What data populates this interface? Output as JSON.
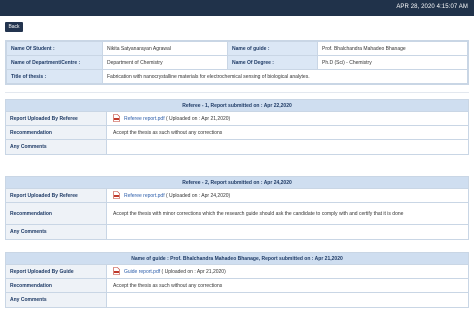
{
  "header": {
    "datetime": "APR 28, 2020   4:15:07 AM"
  },
  "back_label": "Back",
  "student": {
    "name_label": "Name Of Student :",
    "name_value": "Nikita Satyanarayan Agrawal",
    "guide_label": "Name of guide :",
    "guide_value": "Prof. Bhalchandra Mahadeo Bhanage",
    "dept_label": "Name of Department/Centre :",
    "dept_value": "Department of Chemistry",
    "degree_label": "Name Of Degree :",
    "degree_value": "Ph.D (Sci) - Chemistry",
    "thesis_label": "Title of thesis :",
    "thesis_value": "Fabrication with nanocrystalline materials for electrochemical sensing of biological analytes."
  },
  "sections": [
    {
      "title": "Referee - 1, Report submitted on : Apr 22,2020",
      "report_label": "Report Uploaded By Referee",
      "file_link": "Referee report.pdf",
      "file_date": "( Uploaded on : Apr 21,2020)",
      "recommendation_label": "Recommendation",
      "recommendation_value": "Accept the thesis as such without any corrections",
      "comments_label": "Any Comments",
      "comments_value": ""
    },
    {
      "title": "Referee - 2, Report submitted on : Apr 24,2020",
      "report_label": "Report Uploaded By Referee",
      "file_link": "Referee report.pdf",
      "file_date": "( Uploaded on : Apr 24,2020)",
      "recommendation_label": "Recommendation",
      "recommendation_value": "Accept the thesis with minor corrections which the research guide should ask the candidate to comply with and certify that it is done",
      "comments_label": "Any Comments",
      "comments_value": ""
    },
    {
      "title": "Name of guide : Prof. Bhalchandra Mahadeo Bhanage, Report submitted on : Apr 21,2020",
      "report_label": "Report Uploaded By Guide",
      "file_link": "Guide report.pdf",
      "file_date": "( Uploaded on : Apr 21,2020)",
      "recommendation_label": "Recommendation",
      "recommendation_value": "Accept the thesis as such without any corrections",
      "comments_label": "Any Comments",
      "comments_value": ""
    }
  ]
}
